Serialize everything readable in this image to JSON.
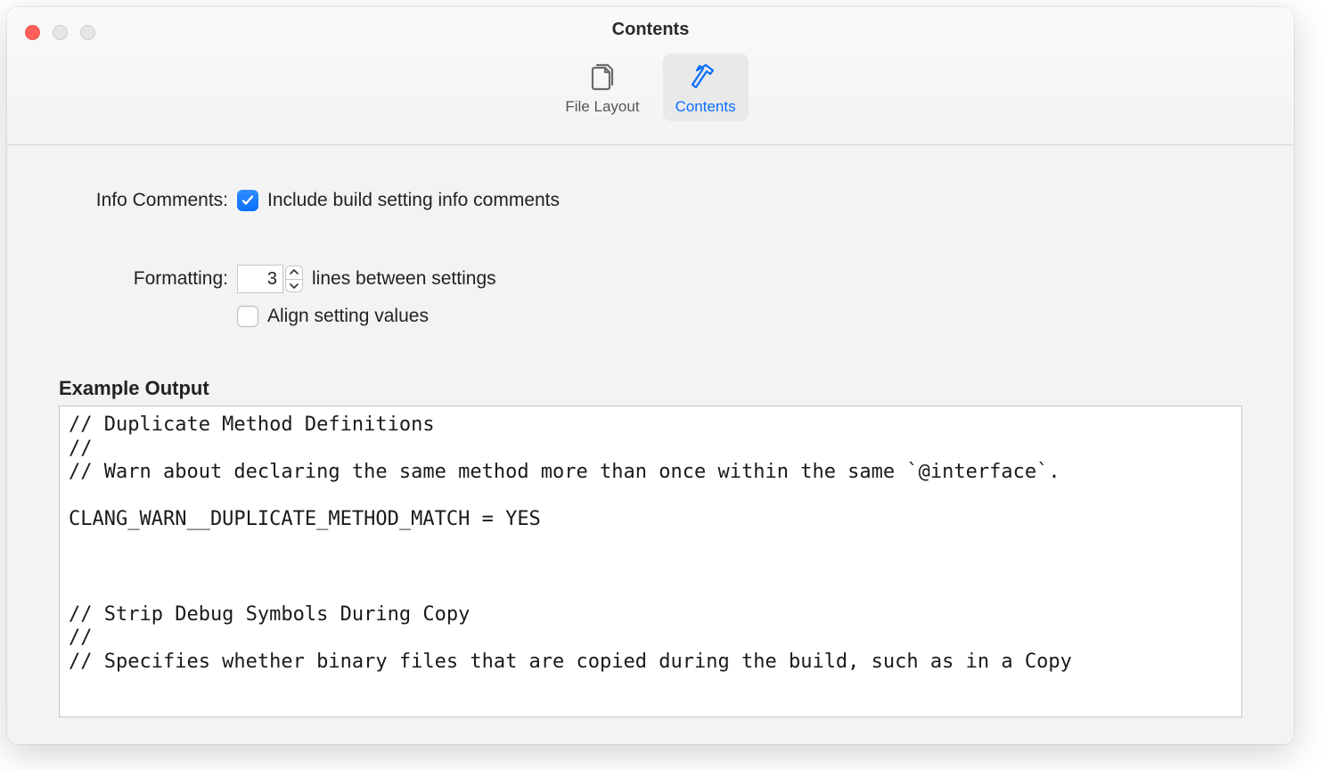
{
  "window": {
    "title": "Contents"
  },
  "toolbar": {
    "items": [
      {
        "label": "File Layout",
        "selected": false
      },
      {
        "label": "Contents",
        "selected": true
      }
    ]
  },
  "form": {
    "info_comments": {
      "label": "Info Comments:",
      "checkbox_label": "Include build setting info comments",
      "checked": true
    },
    "formatting": {
      "label": "Formatting:",
      "lines_value": "3",
      "lines_suffix": "lines between settings",
      "align_label": "Align setting values",
      "align_checked": false
    }
  },
  "example": {
    "title": "Example Output",
    "text": "// Duplicate Method Definitions\n//\n// Warn about declaring the same method more than once within the same `@interface`.\n\nCLANG_WARN__DUPLICATE_METHOD_MATCH = YES\n\n\n\n// Strip Debug Symbols During Copy\n//\n// Specifies whether binary files that are copied during the build, such as in a Copy"
  }
}
